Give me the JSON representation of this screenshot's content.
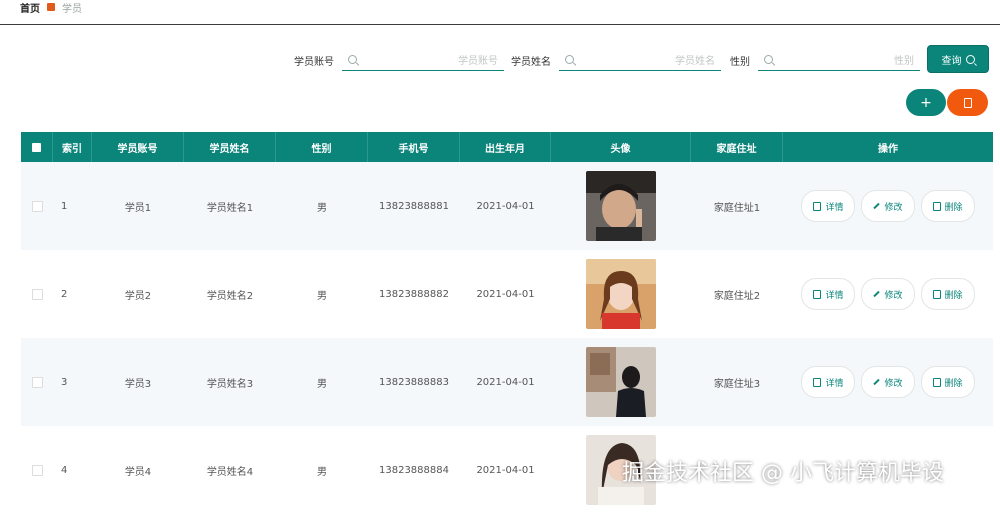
{
  "breadcrumb": {
    "home": "首页",
    "current": "学员"
  },
  "search": {
    "fields": [
      {
        "label": "学员账号",
        "placeholder": "学员账号"
      },
      {
        "label": "学员姓名",
        "placeholder": "学员姓名"
      },
      {
        "label": "性别",
        "placeholder": "性别"
      }
    ],
    "query_label": "查询"
  },
  "toolbar": {
    "add_label": "+"
  },
  "table": {
    "headers": [
      "索引",
      "学员账号",
      "学员姓名",
      "性别",
      "手机号",
      "出生年月",
      "头像",
      "家庭住址",
      "操作"
    ],
    "rows": [
      {
        "index": "1",
        "account": "学员1",
        "name": "学员姓名1",
        "gender": "男",
        "phone": "13823888881",
        "birth": "2021-04-01",
        "address": "家庭住址1"
      },
      {
        "index": "2",
        "account": "学员2",
        "name": "学员姓名2",
        "gender": "男",
        "phone": "13823888882",
        "birth": "2021-04-01",
        "address": "家庭住址2"
      },
      {
        "index": "3",
        "account": "学员3",
        "name": "学员姓名3",
        "gender": "男",
        "phone": "13823888883",
        "birth": "2021-04-01",
        "address": "家庭住址3"
      },
      {
        "index": "4",
        "account": "学员4",
        "name": "学员姓名4",
        "gender": "男",
        "phone": "13823888884",
        "birth": "2021-04-01",
        "address": ""
      }
    ],
    "actions": {
      "detail": "详情",
      "edit": "修改",
      "delete": "删除"
    }
  },
  "watermark": "掘金技术社区 @ 小飞计算机毕设",
  "colors": {
    "primary": "#0b857a",
    "danger": "#f15a0e",
    "alt_row": "#f4f8fa"
  }
}
